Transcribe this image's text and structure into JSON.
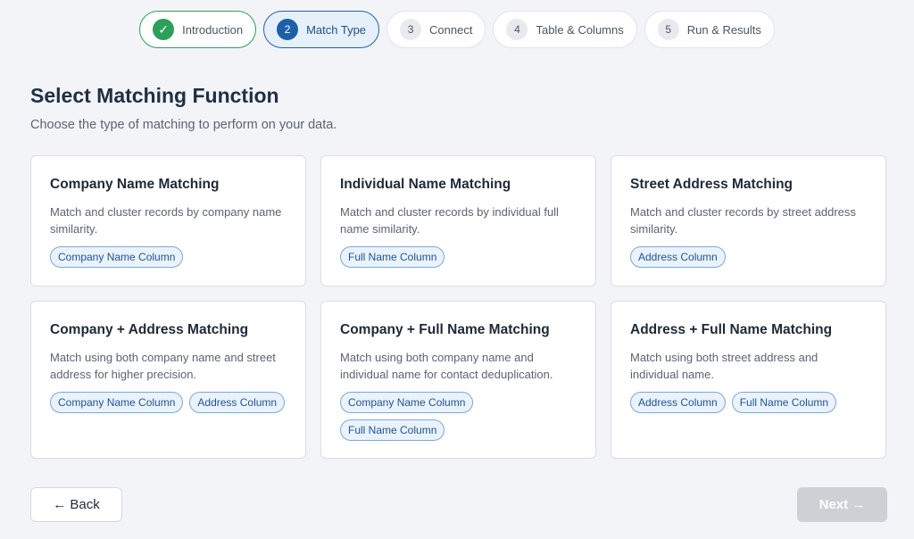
{
  "stepper": {
    "steps": [
      {
        "num": "✓",
        "label": "Introduction",
        "state": "done"
      },
      {
        "num": "2",
        "label": "Match Type",
        "state": "active"
      },
      {
        "num": "3",
        "label": "Connect",
        "state": "pending"
      },
      {
        "num": "4",
        "label": "Table & Columns",
        "state": "pending"
      },
      {
        "num": "5",
        "label": "Run & Results",
        "state": "pending"
      }
    ]
  },
  "header": {
    "title": "Select Matching Function",
    "subtitle": "Choose the type of matching to perform on your data."
  },
  "cards": [
    {
      "title": "Company Name Matching",
      "desc": "Match and cluster records by company name similarity.",
      "tags": [
        "Company Name Column"
      ]
    },
    {
      "title": "Individual Name Matching",
      "desc": "Match and cluster records by individual full name similarity.",
      "tags": [
        "Full Name Column"
      ]
    },
    {
      "title": "Street Address Matching",
      "desc": "Match and cluster records by street address similarity.",
      "tags": [
        "Address Column"
      ]
    },
    {
      "title": "Company + Address Matching",
      "desc": "Match using both company name and street address for higher precision.",
      "tags": [
        "Company Name Column",
        "Address Column"
      ]
    },
    {
      "title": "Company + Full Name Matching",
      "desc": "Match using both company name and individual name for contact deduplication.",
      "tags": [
        "Company Name Column",
        "Full Name Column"
      ]
    },
    {
      "title": "Address + Full Name Matching",
      "desc": "Match using both street address and individual name.",
      "tags": [
        "Address Column",
        "Full Name Column"
      ]
    }
  ],
  "footer": {
    "back_label": "← Back",
    "next_label": "Next →"
  }
}
